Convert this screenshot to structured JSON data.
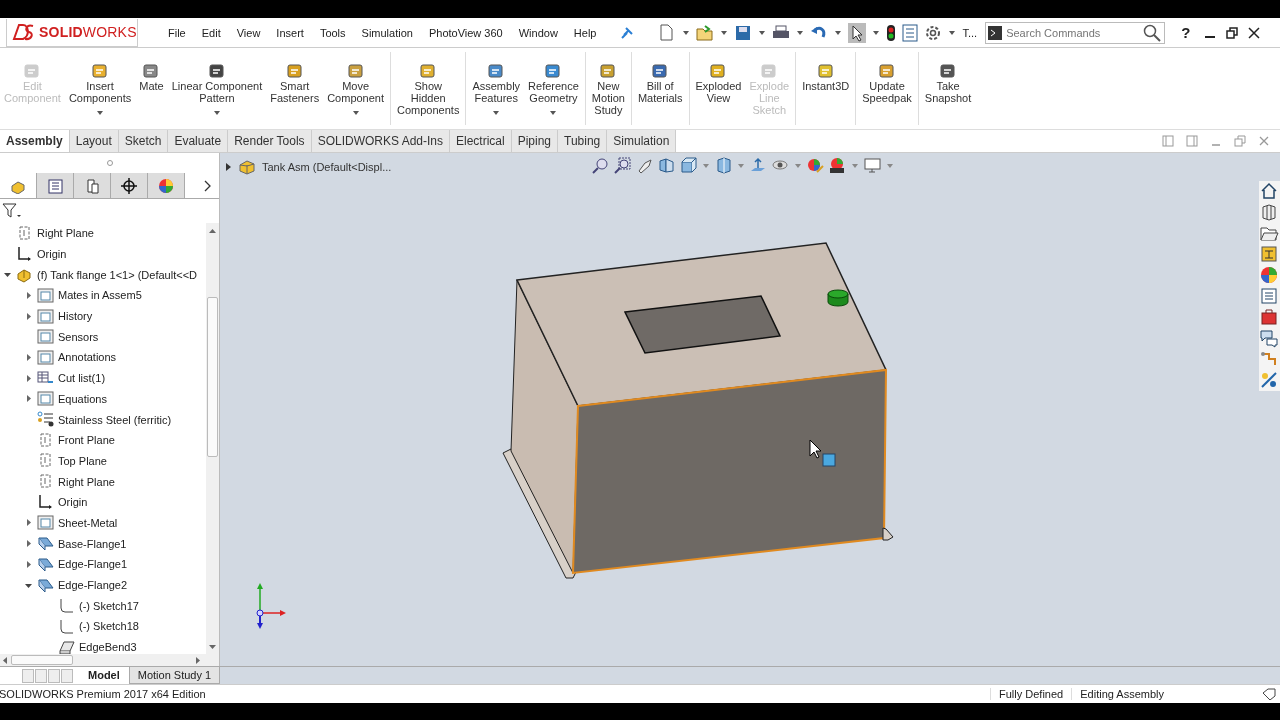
{
  "app": {
    "logo": "**SOLID**WORKS",
    "menu": [
      "File",
      "Edit",
      "View",
      "Insert",
      "Tools",
      "Simulation",
      "PhotoView 360",
      "Window",
      "Help"
    ],
    "quick_label": "T...",
    "search": {
      "placeholder": "Search Commands"
    },
    "help": "?"
  },
  "ribbon": [
    {
      "buttons": [
        {
          "label": "Edit\nComponent",
          "disabled": true,
          "dropdown": false
        },
        {
          "label": "Insert\nComponents",
          "disabled": false,
          "dropdown": true
        },
        {
          "label": "Mate",
          "disabled": false,
          "dropdown": false
        },
        {
          "label": "Linear Component\nPattern",
          "disabled": false,
          "dropdown": true
        },
        {
          "label": "Smart\nFasteners",
          "disabled": false,
          "dropdown": false
        },
        {
          "label": "Move\nComponent",
          "disabled": false,
          "dropdown": true
        }
      ]
    },
    {
      "buttons": [
        {
          "label": "Show\nHidden\nComponents",
          "disabled": false,
          "dropdown": false
        }
      ]
    },
    {
      "buttons": [
        {
          "label": "Assembly\nFeatures",
          "disabled": false,
          "dropdown": true
        },
        {
          "label": "Reference\nGeometry",
          "disabled": false,
          "dropdown": true
        }
      ]
    },
    {
      "buttons": [
        {
          "label": "New\nMotion\nStudy",
          "disabled": false,
          "dropdown": false
        }
      ]
    },
    {
      "buttons": [
        {
          "label": "Bill of\nMaterials",
          "disabled": false,
          "dropdown": false
        }
      ]
    },
    {
      "buttons": [
        {
          "label": "Exploded\nView",
          "disabled": false,
          "dropdown": false
        },
        {
          "label": "Explode\nLine\nSketch",
          "disabled": true,
          "dropdown": false
        }
      ]
    },
    {
      "buttons": [
        {
          "label": "Instant3D",
          "disabled": false,
          "dropdown": false
        }
      ]
    },
    {
      "buttons": [
        {
          "label": "Update\nSpeedpak",
          "disabled": false,
          "dropdown": false
        }
      ]
    },
    {
      "buttons": [
        {
          "label": "Take\nSnapshot",
          "disabled": false,
          "dropdown": false
        }
      ]
    }
  ],
  "panel_tabs": [
    {
      "selected": true
    },
    {
      "selected": false
    },
    {
      "selected": false
    },
    {
      "selected": false
    },
    {
      "selected": false
    }
  ],
  "tabs": [
    {
      "label": "Assembly",
      "selected": true
    },
    {
      "label": "Layout",
      "selected": false
    },
    {
      "label": "Sketch",
      "selected": false
    },
    {
      "label": "Evaluate",
      "selected": false
    },
    {
      "label": "Render Tools",
      "selected": false
    },
    {
      "label": "SOLIDWORKS Add-Ins",
      "selected": false
    },
    {
      "label": "Electrical",
      "selected": false
    },
    {
      "label": "Piping",
      "selected": false
    },
    {
      "label": "Tubing",
      "selected": false
    },
    {
      "label": "Simulation",
      "selected": false
    }
  ],
  "tree": [
    {
      "label": "Right Plane",
      "kind": "plane"
    },
    {
      "label": "Origin",
      "kind": "origin"
    },
    {
      "label": "(f) Tank flange 1<1> (Default<<D",
      "kind": "part",
      "expanded": true,
      "children": [
        {
          "label": "Mates in Assem5",
          "kind": "folder",
          "expanded": false
        },
        {
          "label": "History",
          "kind": "folder",
          "expanded": false
        },
        {
          "label": "Sensors",
          "kind": "folder"
        },
        {
          "label": "Annotations",
          "kind": "folder",
          "expanded": false
        },
        {
          "label": "Cut list(1)",
          "kind": "cutlist",
          "expanded": false
        },
        {
          "label": "Equations",
          "kind": "folder",
          "expanded": false
        },
        {
          "label": "Stainless Steel (ferritic)",
          "kind": "material"
        },
        {
          "label": "Front Plane",
          "kind": "plane"
        },
        {
          "label": "Top Plane",
          "kind": "plane"
        },
        {
          "label": "Right Plane",
          "kind": "plane"
        },
        {
          "label": "Origin",
          "kind": "origin"
        },
        {
          "label": "Sheet-Metal",
          "kind": "folder",
          "expanded": false
        },
        {
          "label": "Base-Flange1",
          "kind": "flange",
          "expanded": false
        },
        {
          "label": "Edge-Flange1",
          "kind": "flange",
          "expanded": false
        },
        {
          "label": "Edge-Flange2",
          "kind": "flange",
          "expanded": true,
          "children": [
            {
              "label": "(-) Sketch17",
              "kind": "sketch"
            },
            {
              "label": "(-) Sketch18",
              "kind": "sketch"
            },
            {
              "label": "EdgeBend3",
              "kind": "bend"
            }
          ]
        }
      ]
    }
  ],
  "viewport": {
    "title": "Tank Asm  (Default<Displ..."
  },
  "bottom_tabs": [
    {
      "label": "Model",
      "selected": true
    },
    {
      "label": "Motion Study 1",
      "selected": false
    }
  ],
  "status": {
    "edition": "SOLIDWORKS Premium 2017 x64 Edition",
    "items": [
      "Fully Defined",
      "Editing Assembly"
    ]
  }
}
